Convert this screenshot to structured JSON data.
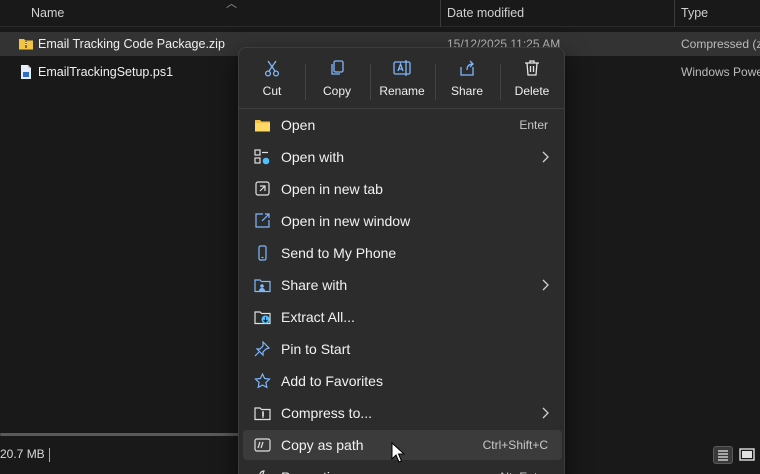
{
  "columns": {
    "name": "Name",
    "date_modified": "Date modified",
    "type": "Type"
  },
  "files": [
    {
      "name": "Email Tracking Code Package.zip",
      "date": "15/12/2025 11:25 AM",
      "type": "Compressed (zi",
      "icon": "zip-folder-icon",
      "selected": true
    },
    {
      "name": "EmailTrackingSetup.ps1",
      "date": "",
      "type": "Windows Powe",
      "icon": "powershell-script-icon",
      "selected": false
    }
  ],
  "quick_actions": [
    {
      "label": "Cut",
      "icon": "scissors-icon"
    },
    {
      "label": "Copy",
      "icon": "copy-icon"
    },
    {
      "label": "Rename",
      "icon": "rename-icon"
    },
    {
      "label": "Share",
      "icon": "share-icon"
    },
    {
      "label": "Delete",
      "icon": "trash-icon"
    }
  ],
  "menu_items": [
    {
      "label": "Open",
      "shortcut": "Enter",
      "submenu": false,
      "icon": "folder-icon"
    },
    {
      "label": "Open with",
      "shortcut": "",
      "submenu": true,
      "icon": "open-with-icon"
    },
    {
      "label": "Open in new tab",
      "shortcut": "",
      "submenu": false,
      "icon": "new-tab-icon"
    },
    {
      "label": "Open in new window",
      "shortcut": "",
      "submenu": false,
      "icon": "new-window-icon"
    },
    {
      "label": "Send to My Phone",
      "shortcut": "",
      "submenu": false,
      "icon": "phone-icon"
    },
    {
      "label": "Share with",
      "shortcut": "",
      "submenu": true,
      "icon": "share-with-icon"
    },
    {
      "label": "Extract All...",
      "shortcut": "",
      "submenu": false,
      "icon": "extract-icon"
    },
    {
      "label": "Pin to Start",
      "shortcut": "",
      "submenu": false,
      "icon": "pin-icon"
    },
    {
      "label": "Add to Favorites",
      "shortcut": "",
      "submenu": false,
      "icon": "star-icon"
    },
    {
      "label": "Compress to...",
      "shortcut": "",
      "submenu": true,
      "icon": "compress-icon"
    },
    {
      "label": "Copy as path",
      "shortcut": "Ctrl+Shift+C",
      "submenu": false,
      "icon": "copy-path-icon"
    },
    {
      "label": "Properties",
      "shortcut": "Alt+Enter",
      "submenu": false,
      "icon": "properties-icon"
    }
  ],
  "status": {
    "selection_size": "20.7 MB"
  },
  "colors": {
    "accent": "#4cc2ff",
    "folder": "#f5c344",
    "menu_bg": "#2c2c2c"
  }
}
